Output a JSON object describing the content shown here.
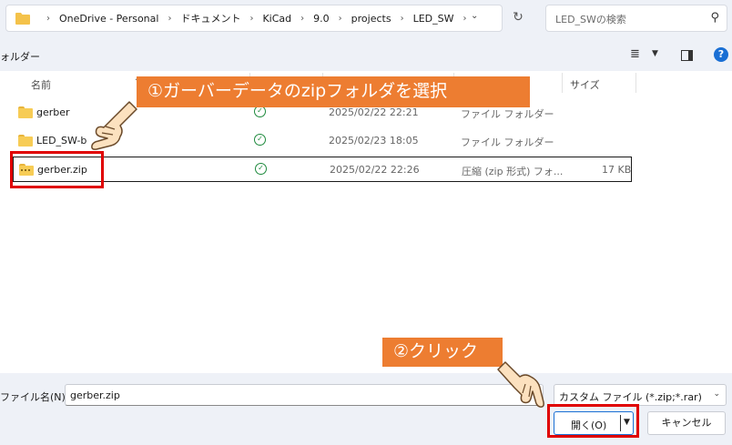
{
  "address": {
    "crumbs": [
      "OneDrive - Personal",
      "ドキュメント",
      "KiCad",
      "9.0",
      "projects",
      "LED_SW"
    ],
    "search_placeholder": "LED_SWの検索"
  },
  "toolbar": {
    "left_text": "ォルダー"
  },
  "columns": {
    "name": "名前",
    "size": "サイズ"
  },
  "files": [
    {
      "name": "gerber",
      "date": "2025/02/22 22:21",
      "type": "ファイル フォルダー",
      "size": "",
      "icon": "folder"
    },
    {
      "name": "LED_SW-b",
      "date": "2025/02/23 18:05",
      "type": "ファイル フォルダー",
      "size": "",
      "icon": "folder"
    },
    {
      "name": "gerber.zip",
      "date": "2025/02/22 22:26",
      "type": "圧縮 (zip 形式) フォ...",
      "size": "17 KB",
      "icon": "zip-folder"
    }
  ],
  "bottom": {
    "filename_label": "ファイル名(N):",
    "filename_value": "gerber.zip",
    "filter_value": "カスタム ファイル (*.zip;*.rar)",
    "open_label": "開く(O)",
    "cancel_label": "キャンセル"
  },
  "annotations": {
    "step1": "①ガーバーデータのzipフォルダを選択",
    "step2": "②クリック",
    "callout_color": "#ed7d31",
    "highlight_color": "#e00000"
  }
}
